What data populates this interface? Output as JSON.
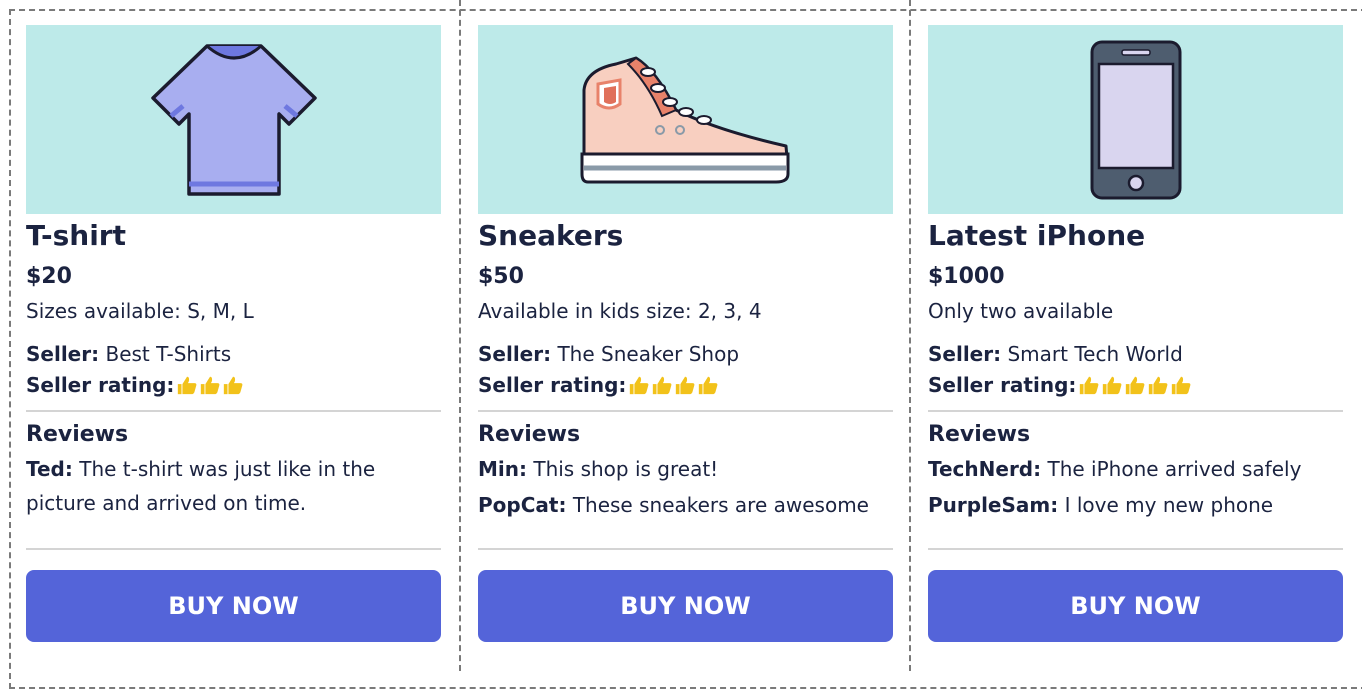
{
  "colors": {
    "image_bg": "#bdeae9",
    "button_bg": "#5464d9",
    "button_text": "#ffffff",
    "text": "#1b2340",
    "thumb": "#f2c21a"
  },
  "products": [
    {
      "name": "T-shirt",
      "price": "$20",
      "description": "Sizes available: S, M, L",
      "seller_label": "Seller:",
      "seller": "Best T-Shirts",
      "rating_label": "Seller rating:",
      "rating": 3,
      "reviews_title": "Reviews",
      "reviews": [
        {
          "author": "Ted:",
          "text": "The t-shirt was just like in the picture and arrived on time."
        }
      ],
      "buy_label": "BUY NOW",
      "icon": "tshirt-icon"
    },
    {
      "name": "Sneakers",
      "price": "$50",
      "description": "Available in kids size: 2, 3, 4",
      "seller_label": "Seller:",
      "seller": "The Sneaker Shop",
      "rating_label": "Seller rating:",
      "rating": 4,
      "reviews_title": "Reviews",
      "reviews": [
        {
          "author": "Min:",
          "text": "This shop is great!"
        },
        {
          "author": "PopCat:",
          "text": "These sneakers are awesome"
        }
      ],
      "buy_label": "BUY NOW",
      "icon": "sneaker-icon"
    },
    {
      "name": "Latest iPhone",
      "price": "$1000",
      "description": "Only two available",
      "seller_label": "Seller:",
      "seller": "Smart Tech World",
      "rating_label": "Seller rating:",
      "rating": 5,
      "reviews_title": "Reviews",
      "reviews": [
        {
          "author": "TechNerd:",
          "text": "The iPhone arrived safely"
        },
        {
          "author": "PurpleSam:",
          "text": "I love my new phone"
        }
      ],
      "buy_label": "BUY NOW",
      "icon": "phone-icon"
    }
  ]
}
